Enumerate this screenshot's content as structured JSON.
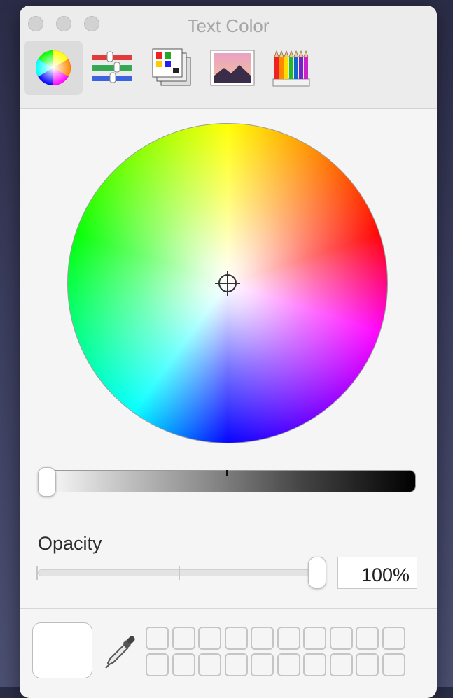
{
  "window": {
    "title": "Text Color"
  },
  "toolbar": {
    "modes": [
      {
        "name": "color-wheel",
        "selected": true
      },
      {
        "name": "color-sliders",
        "selected": false
      },
      {
        "name": "color-palettes",
        "selected": false
      },
      {
        "name": "image-palettes",
        "selected": false
      },
      {
        "name": "pencils",
        "selected": false
      }
    ]
  },
  "wheel": {
    "selected_color": "#ffffff"
  },
  "brightness": {
    "value_fraction": 1.0
  },
  "opacity": {
    "label": "Opacity",
    "value_fraction": 1.0,
    "value_text": "100%"
  },
  "swatches": {
    "current": "#ffffff",
    "slots": 20
  }
}
